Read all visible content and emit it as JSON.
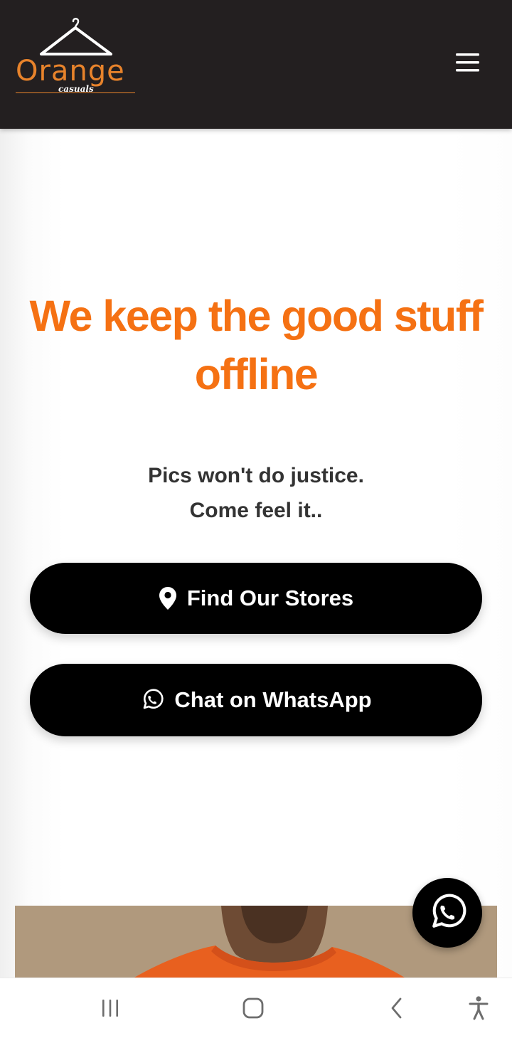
{
  "header": {
    "logo": {
      "brand_word": "Orange",
      "brand_sub": "casuals"
    },
    "menu_icon": "hamburger-menu-icon"
  },
  "hero": {
    "headline": "We keep the good stuff offline",
    "subline_1": "Pics won't do justice.",
    "subline_2": "Come feel it..",
    "buttons": [
      {
        "label": "Find Our Stores",
        "icon": "map-pin-icon"
      },
      {
        "label": "Chat on WhatsApp",
        "icon": "whatsapp-icon"
      }
    ]
  },
  "floating_button": {
    "icon": "whatsapp-icon"
  },
  "system_nav": {
    "buttons": [
      "recent-apps-icon",
      "home-icon",
      "back-icon",
      "accessibility-icon"
    ]
  },
  "colors": {
    "header_bg": "#231f20",
    "accent_orange": "#f57113",
    "logo_orange": "#e8832b",
    "button_bg": "#000000",
    "subtext": "#333333"
  }
}
